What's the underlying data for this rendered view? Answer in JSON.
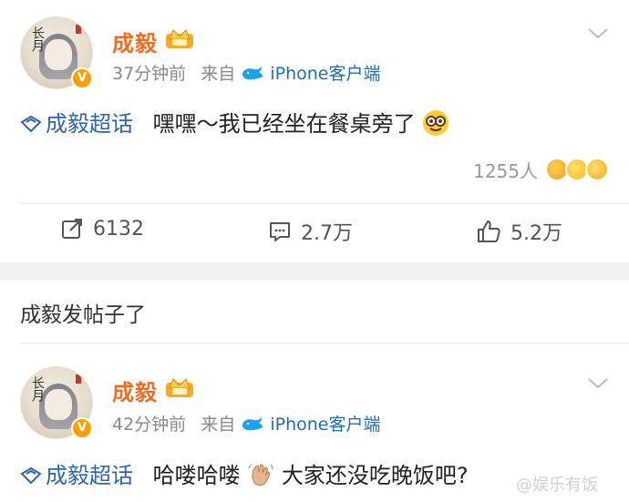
{
  "post1": {
    "author": "成毅",
    "time": "37分钟前",
    "source_prefix": "来自",
    "source": "iPhone客户端",
    "topic": "成毅超话",
    "text": "嘿嘿～我已经坐在餐桌旁了",
    "reaction_count": "1255人",
    "actions": {
      "share": "6132",
      "comment": "2.7万",
      "like": "5.2万"
    }
  },
  "section_title": "成毅发帖子了",
  "post2": {
    "author": "成毅",
    "time": "42分钟前",
    "source_prefix": "来自",
    "source": "iPhone客户端",
    "topic": "成毅超话",
    "text_a": "哈喽哈喽",
    "text_b": "大家还没吃晚饭吧?"
  },
  "watermark": "@娱乐有饭",
  "colors": {
    "author": "#f26d1f",
    "topic": "#2b66b1",
    "verified": "#ff9f00",
    "source": "#1da1f2"
  },
  "icons": [
    "crown-badge-icon",
    "whale-icon",
    "chevron-down-icon",
    "super-topic-icon",
    "nerd-face-emoji",
    "share-icon",
    "comment-icon",
    "like-icon",
    "waving-hand-emoji"
  ]
}
